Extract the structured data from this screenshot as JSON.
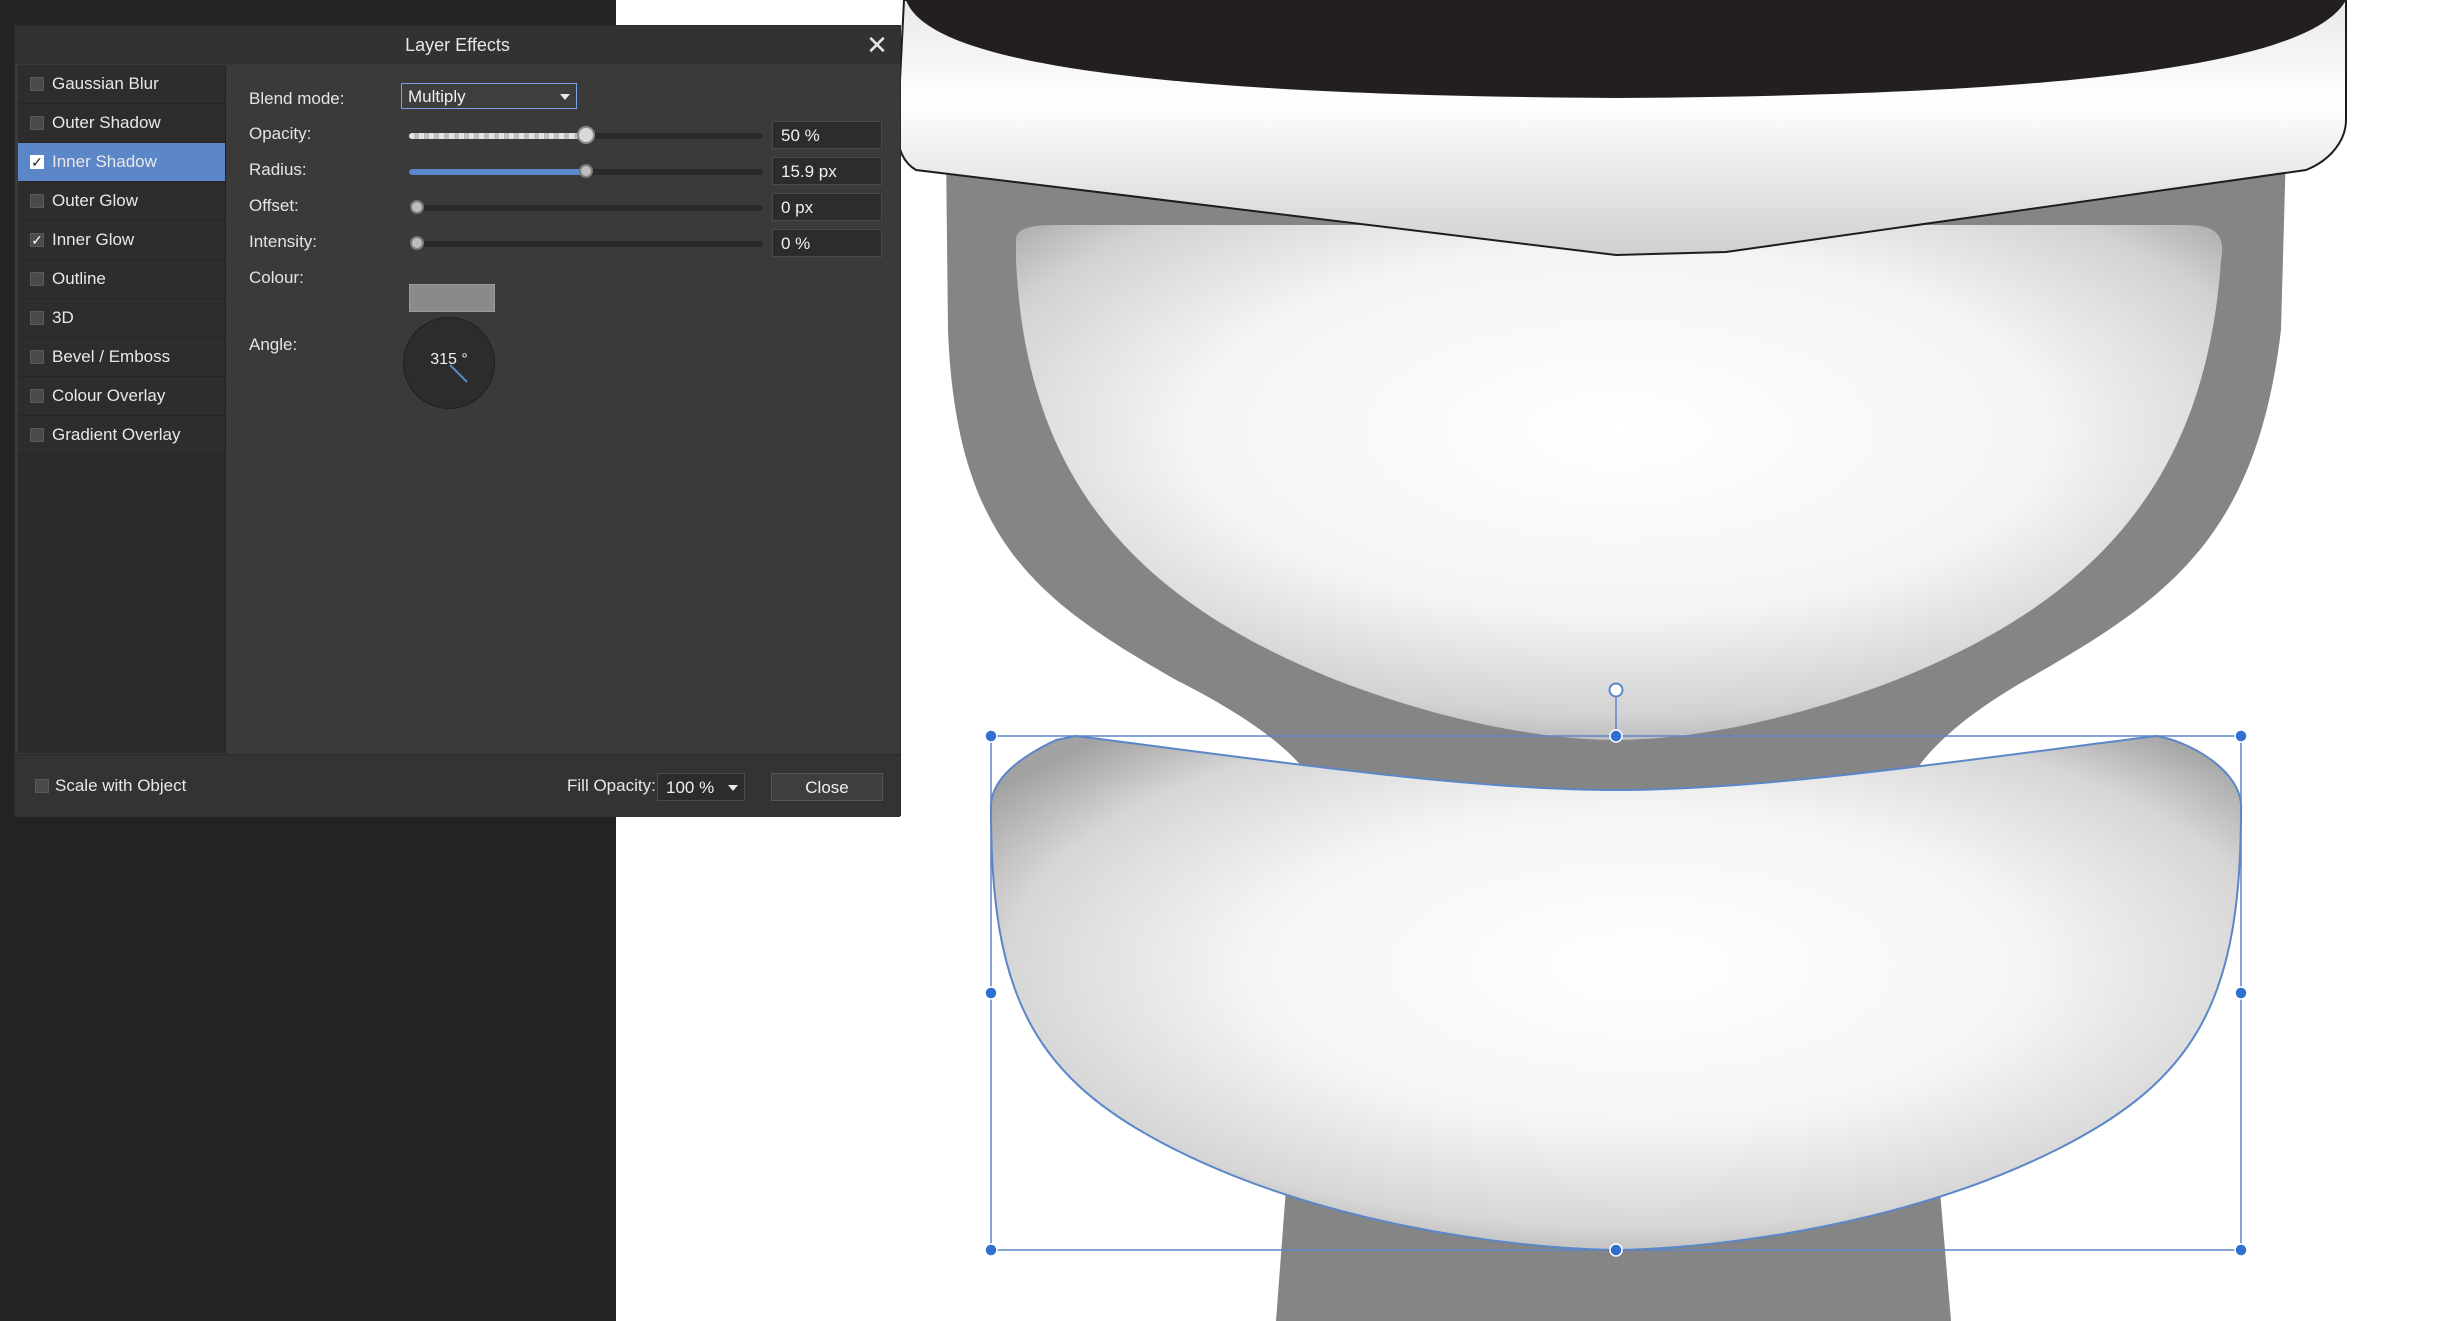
{
  "dialog": {
    "title": "Layer Effects",
    "effects": [
      {
        "label": "Gaussian Blur",
        "checked": false,
        "selected": false
      },
      {
        "label": "Outer Shadow",
        "checked": false,
        "selected": false
      },
      {
        "label": "Inner Shadow",
        "checked": true,
        "selected": true
      },
      {
        "label": "Outer Glow",
        "checked": false,
        "selected": false
      },
      {
        "label": "Inner Glow",
        "checked": true,
        "selected": false
      },
      {
        "label": "Outline",
        "checked": false,
        "selected": false
      },
      {
        "label": "3D",
        "checked": false,
        "selected": false
      },
      {
        "label": "Bevel / Emboss",
        "checked": false,
        "selected": false
      },
      {
        "label": "Colour Overlay",
        "checked": false,
        "selected": false
      },
      {
        "label": "Gradient Overlay",
        "checked": false,
        "selected": false
      }
    ],
    "blend_mode": {
      "label": "Blend mode:",
      "value": "Multiply"
    },
    "opacity": {
      "label": "Opacity:",
      "value": "50 %",
      "fraction": 0.5
    },
    "radius": {
      "label": "Radius:",
      "value": "15.9 px",
      "fraction": 0.5
    },
    "offset": {
      "label": "Offset:",
      "value": "0 px",
      "fraction": 0.0
    },
    "intensity": {
      "label": "Intensity:",
      "value": "0 %",
      "fraction": 0.0
    },
    "colour": {
      "label": "Colour:",
      "swatch": "#8a8a8a"
    },
    "angle": {
      "label": "Angle:",
      "value": "315 °"
    },
    "footer": {
      "scale_with_object": "Scale with Object",
      "fill_opacity_label": "Fill Opacity:",
      "fill_opacity_value": "100 %",
      "close_label": "Close"
    }
  },
  "colors": {
    "accent": "#5b86c8",
    "panel": "#3a3a3a",
    "workspace": "#232323",
    "canvas": "#ffffff"
  }
}
